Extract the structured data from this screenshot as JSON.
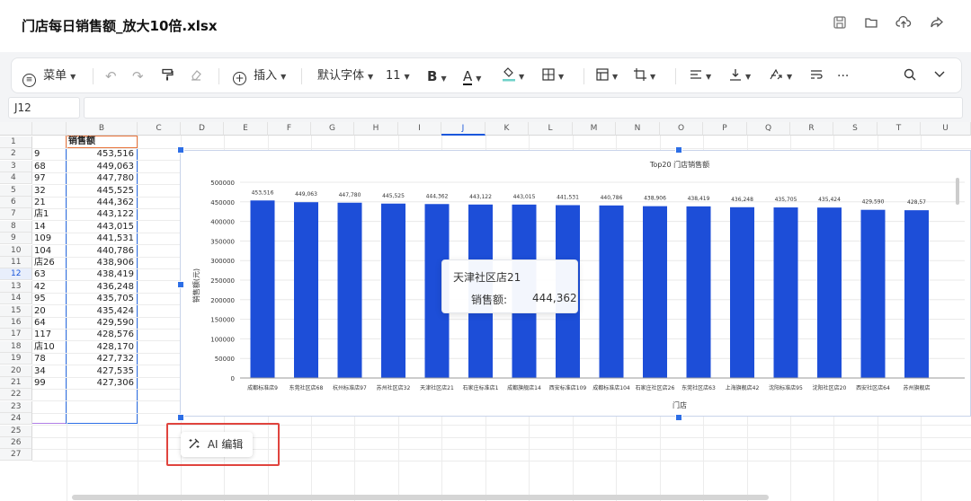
{
  "window": {
    "title": "门店每日销售额_放大10倍.xlsx"
  },
  "title_icons": [
    "save-icon",
    "folder-icon",
    "upload-icon",
    "share-icon"
  ],
  "toolbar": {
    "menu_label": "菜单",
    "insert_label": "插入",
    "font_name": "默认字体",
    "font_size": "11",
    "bold_label": "B",
    "font_color_label": "A",
    "more_label": "···"
  },
  "formula_bar": {
    "cell_ref": "J12",
    "content": ""
  },
  "columns": [
    "B",
    "C",
    "D",
    "E",
    "F",
    "G",
    "H",
    "I",
    "J",
    "K",
    "L",
    "M",
    "N",
    "O",
    "P",
    "Q",
    "R",
    "S",
    "T",
    "U"
  ],
  "selected_column": "J",
  "rows": [
    "1",
    "2",
    "3",
    "4",
    "5",
    "6",
    "7",
    "8",
    "9",
    "10",
    "11",
    "12",
    "13",
    "14",
    "15",
    "16",
    "17",
    "18",
    "19",
    "20",
    "21",
    "22",
    "23",
    "24",
    "25",
    "26",
    "27"
  ],
  "selected_row": "12",
  "sheet": {
    "header_b": "销售额",
    "col_a": [
      "9",
      "68",
      "97",
      "32",
      "21",
      "店1",
      "14",
      "109",
      "104",
      "店26",
      "63",
      "42",
      "95",
      "20",
      "64",
      "117",
      "店10",
      "78",
      "34",
      "99"
    ],
    "col_b": [
      "453,516",
      "449,063",
      "447,780",
      "445,525",
      "444,362",
      "443,122",
      "443,015",
      "441,531",
      "440,786",
      "438,906",
      "438,419",
      "436,248",
      "435,705",
      "435,424",
      "429,590",
      "428,576",
      "428,170",
      "427,732",
      "427,535",
      "427,306"
    ]
  },
  "chart_data": {
    "type": "bar",
    "title": "Top20 门店销售额",
    "xlabel": "门店",
    "ylabel": "销售额(元)",
    "ylim": [
      0,
      500000
    ],
    "yticks": [
      "500000",
      "450000",
      "400000",
      "350000",
      "300000",
      "250000",
      "200000",
      "150000",
      "100000",
      "50000",
      "0"
    ],
    "categories": [
      "成都标准店9",
      "东莞社区店68",
      "杭州标准店97",
      "苏州社区店32",
      "天津社区店21",
      "石家庄标准店1",
      "成都旗舰店14",
      "西安标准店109",
      "成都标准店104",
      "石家庄社区店26",
      "东莞社区店63",
      "上海旗舰店42",
      "沈阳标准店95",
      "沈阳社区店20",
      "西安社区店64",
      "苏州旗舰店"
    ],
    "values": [
      453516,
      449063,
      447780,
      445525,
      444362,
      443122,
      443015,
      441531,
      440786,
      438906,
      438419,
      436248,
      435705,
      435424,
      429590,
      428576
    ],
    "data_labels": [
      "453,516",
      "449,063",
      "447,780",
      "445,525",
      "444,362",
      "443,122",
      "443,015",
      "441,531",
      "440,786",
      "438,906",
      "438,419",
      "436,248",
      "435,705",
      "435,424",
      "429,590",
      "428,57"
    ],
    "color": "#1d4ed8",
    "tooltip": {
      "title": "天津社区店21",
      "label": "销售额:",
      "value": "444,362"
    }
  },
  "ai_edit": {
    "label": "AI 编辑"
  }
}
